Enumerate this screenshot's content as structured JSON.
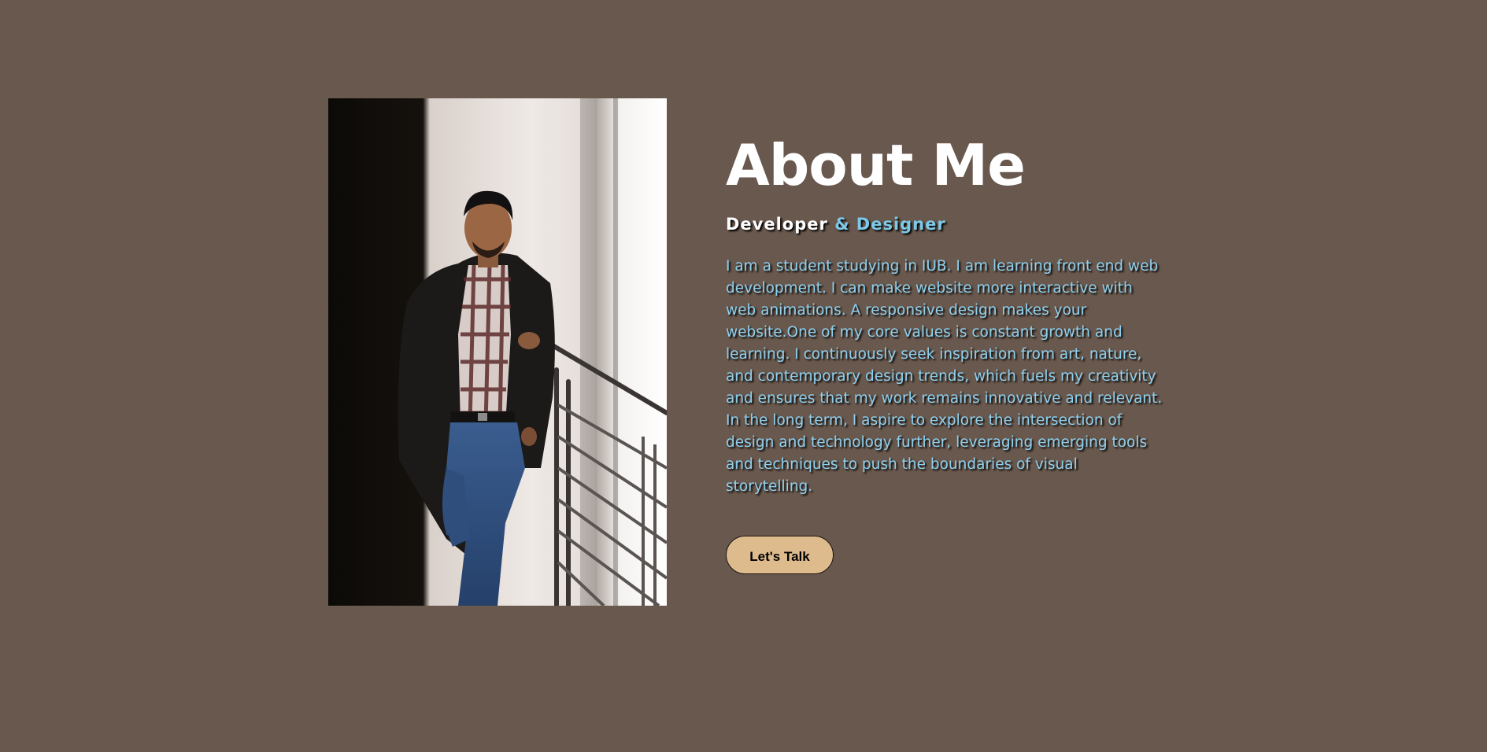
{
  "about": {
    "title": "About Me",
    "subtitle_part1": "Developer",
    "subtitle_part2": "& Designer",
    "description": "I am a student studying in IUB. I am learning front end web development. I can make website more interactive with web animations. A responsive design makes your website.One of my core values is constant growth and learning. I continuously seek inspiration from art, nature, and contemporary design trends, which fuels my creativity and ensures that my work remains innovative and relevant. In the long term, I aspire to explore the intersection of design and technology further, leveraging emerging tools and techniques to push the boundaries of visual storytelling.",
    "cta_label": "Let's Talk"
  },
  "colors": {
    "background": "#69584d",
    "accent": "#7ec8e8",
    "button": "#debb8d"
  },
  "image": {
    "subject": "portrait-photo"
  }
}
